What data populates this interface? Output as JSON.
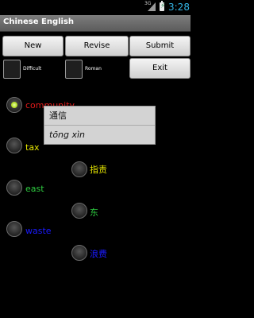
{
  "status_bar": {
    "network": "3G",
    "time": "3:28",
    "signal_icon": "signal-icon",
    "battery_icon": "battery-charging-icon"
  },
  "app": {
    "title": "Chinese English"
  },
  "buttons": {
    "new": "New",
    "revise": "Revise",
    "submit": "Submit",
    "exit": "Exit"
  },
  "options": {
    "difficult": "Difficult",
    "roman": "Roman"
  },
  "answers": [
    {
      "label": "community",
      "color": "#e01a1a",
      "selected": true
    },
    {
      "label": "tax",
      "color": "#e6e600",
      "selected": false
    },
    {
      "label": "指责",
      "color": "#e6e600",
      "selected": false
    },
    {
      "label": "east",
      "color": "#2ecc40",
      "selected": false
    },
    {
      "label": "东",
      "color": "#2ecc40",
      "selected": false
    },
    {
      "label": "waste",
      "color": "#1a1aff",
      "selected": false
    },
    {
      "label": "浪费",
      "color": "#1a1aff",
      "selected": false
    }
  ],
  "popup": {
    "hanzi": "通信",
    "pinyin": "tōng xìn"
  }
}
